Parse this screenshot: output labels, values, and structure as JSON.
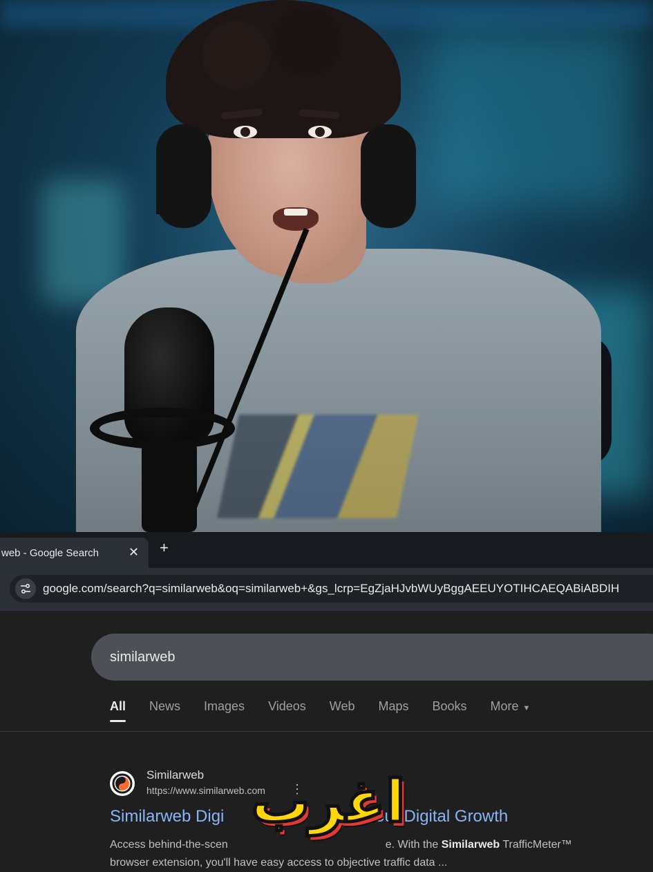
{
  "browser": {
    "tab": {
      "title": "web - Google Search"
    },
    "address_bar": {
      "url": "google.com/search?q=similarweb&oq=similarweb+&gs_lcrp=EgZjaHJvbWUyBggAEEUYOTIHCAEQABiABDIH"
    }
  },
  "search": {
    "query": "similarweb",
    "tabs": [
      {
        "label": "All",
        "active": true
      },
      {
        "label": "News",
        "active": false
      },
      {
        "label": "Images",
        "active": false
      },
      {
        "label": "Videos",
        "active": false
      },
      {
        "label": "Web",
        "active": false
      },
      {
        "label": "Maps",
        "active": false
      },
      {
        "label": "Books",
        "active": false
      },
      {
        "label": "More",
        "active": false
      }
    ]
  },
  "result": {
    "site_name": "Similarweb",
    "site_url": "https://www.similarweb.com",
    "title_left": "Similarweb Digi",
    "title_right": "Your Digital Growth",
    "snippet_part1": "Access behind-the-scen",
    "snippet_part2": "e. With the",
    "snippet_bold1": "Similarweb",
    "snippet_part3": "TrafficMeter™",
    "snippet_line2": "browser extension, you'll have easy access to objective traffic data ..."
  },
  "caption": {
    "text": "اغرب"
  },
  "colors": {
    "link": "#8ab4f8",
    "caption_fill": "#ffd60a",
    "caption_shadow": "#e53935",
    "page_bg": "#1f1f1f"
  }
}
